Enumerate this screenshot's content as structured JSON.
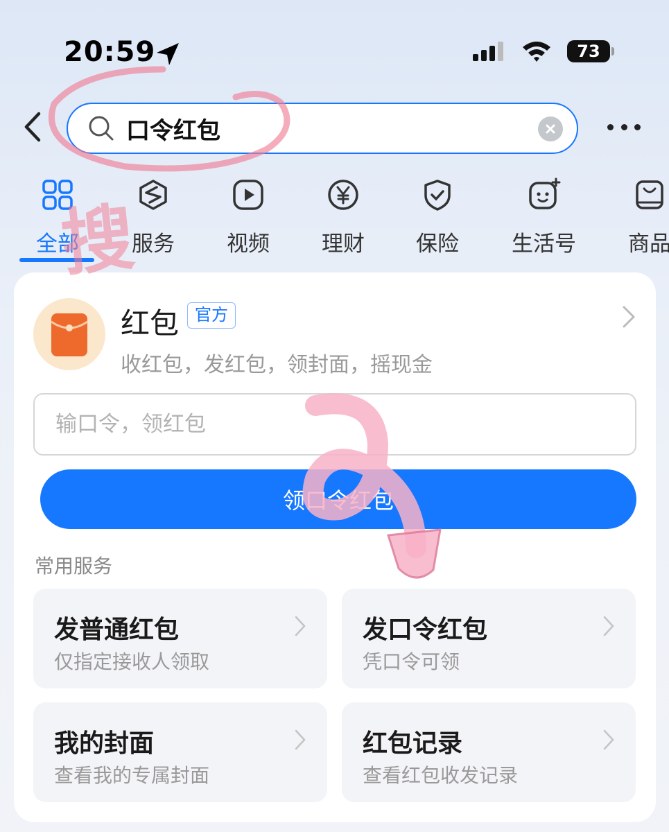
{
  "status_bar": {
    "time": "20:59",
    "battery": "73"
  },
  "search": {
    "query": "口令红包"
  },
  "tabs": [
    {
      "label": "全部",
      "icon": "grid-icon",
      "active": true
    },
    {
      "label": "服务",
      "icon": "service-icon"
    },
    {
      "label": "视频",
      "icon": "play-icon"
    },
    {
      "label": "理财",
      "icon": "yen-icon"
    },
    {
      "label": "保险",
      "icon": "shield-icon"
    },
    {
      "label": "生活号",
      "icon": "life-account-icon"
    },
    {
      "label": "商品",
      "icon": "shopping-bag-icon"
    }
  ],
  "red_packet": {
    "title": "红包",
    "badge": "官方",
    "description": "收红包，发红包，领封面，摇现金",
    "input_placeholder": "输口令，领红包",
    "claim_button": "领口令红包",
    "icon": "red-envelope-icon"
  },
  "services": {
    "section_title": "常用服务",
    "items": [
      {
        "title": "发普通红包",
        "subtitle": "仅指定接收人领取"
      },
      {
        "title": "发口令红包",
        "subtitle": "凭口令可领"
      },
      {
        "title": "我的封面",
        "subtitle": "查看我的专属封面"
      },
      {
        "title": "红包记录",
        "subtitle": "查看红包收发记录"
      }
    ]
  },
  "annotations": {
    "handwritten": "搜",
    "color": "#f0809a"
  },
  "colors": {
    "accent": "#1677ff",
    "envelope": "#ee6a2c",
    "envelope_bg": "#fbe7cc"
  }
}
